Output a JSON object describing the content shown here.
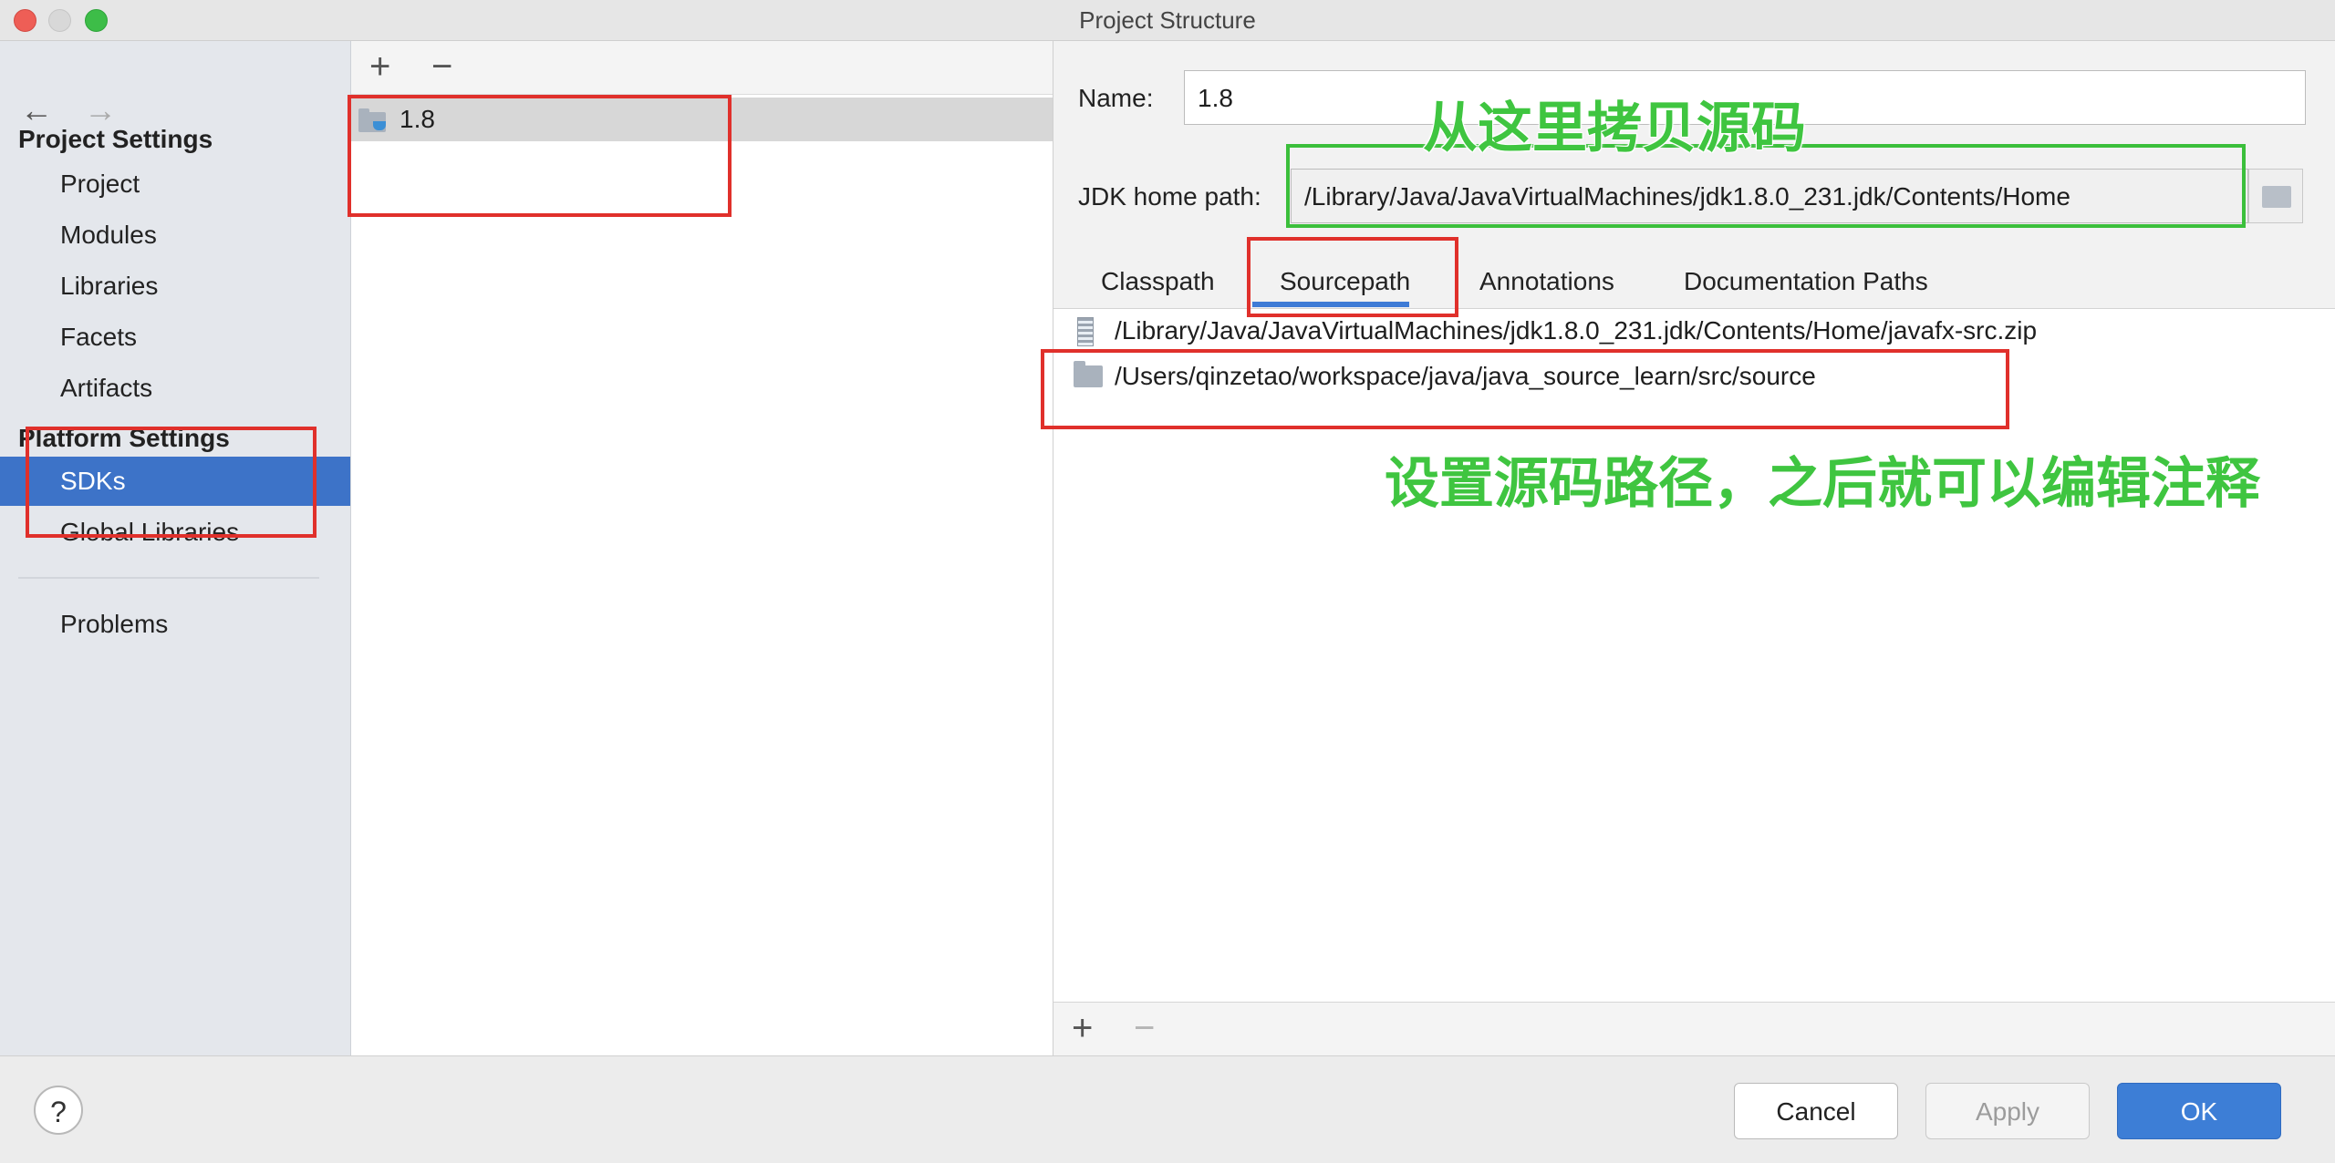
{
  "window": {
    "title": "Project Structure"
  },
  "nav": {
    "back_icon": "←",
    "forward_icon": "→",
    "project_settings_heading": "Project Settings",
    "project_items": [
      "Project",
      "Modules",
      "Libraries",
      "Facets",
      "Artifacts"
    ],
    "platform_settings_heading": "Platform Settings",
    "platform_items": [
      "SDKs",
      "Global Libraries"
    ],
    "selected": "SDKs",
    "problems": "Problems"
  },
  "sdk_list": {
    "add_icon": "+",
    "remove_icon": "−",
    "items": [
      "1.8"
    ]
  },
  "detail": {
    "name_label": "Name:",
    "name_value": "1.8",
    "jdk_home_label": "JDK home path:",
    "jdk_home_value": "/Library/Java/JavaVirtualMachines/jdk1.8.0_231.jdk/Contents/Home",
    "tabs": [
      "Classpath",
      "Sourcepath",
      "Annotations",
      "Documentation Paths"
    ],
    "active_tab": "Sourcepath",
    "paths": [
      "/Library/Java/JavaVirtualMachines/jdk1.8.0_231.jdk/Contents/Home/javafx-src.zip",
      "/Users/qinzetao/workspace/java/java_source_learn/src/source"
    ],
    "add_icon": "+",
    "remove_icon": "−"
  },
  "footer": {
    "help_icon": "?",
    "cancel": "Cancel",
    "apply": "Apply",
    "ok": "OK"
  },
  "annotations": {
    "copy_source_note": "从这里拷贝源码",
    "set_source_note": "设置源码路径，之后就可以编辑注释"
  },
  "colors": {
    "selection": "#3d73c8",
    "accent": "#3e7bd6",
    "annotation_red": "#e0302b",
    "annotation_green": "#3bbf3b"
  }
}
